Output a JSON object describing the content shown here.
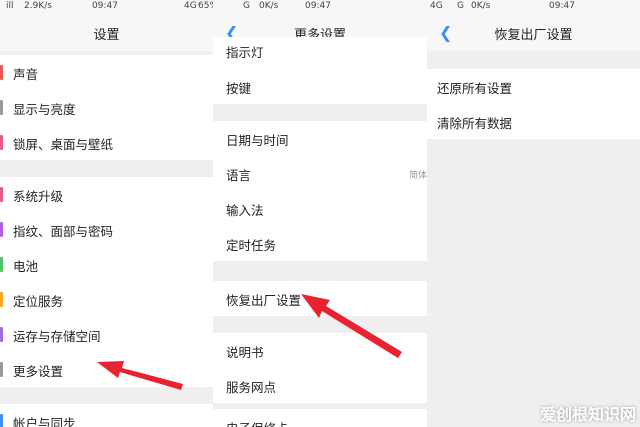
{
  "panel1": {
    "status": {
      "signal": "ill",
      "speed": "2.9K/s",
      "time": "09:47",
      "net": "4G",
      "battery": "65%"
    },
    "title": "设置",
    "items": [
      {
        "label": "声音",
        "color": "#e85a4f"
      },
      {
        "label": "显示与亮度",
        "color": "#999999"
      },
      {
        "label": "锁屏、桌面与壁纸",
        "color": "#e85a8f"
      },
      {
        "label": "系统升级",
        "color": "#e85a8f"
      },
      {
        "label": "指纹、面部与密码",
        "color": "#b35de0"
      },
      {
        "label": "电池",
        "color": "#4fc463"
      },
      {
        "label": "定位服务",
        "color": "#f5a623"
      },
      {
        "label": "运存与存储空间",
        "color": "#9b6de0"
      },
      {
        "label": "更多设置",
        "color": "#999999"
      },
      {
        "label": "帐户与同步",
        "color": "#3d8ef0"
      }
    ]
  },
  "panel2": {
    "status": {
      "signal": "G",
      "speed": "0K/s",
      "time": "09:47"
    },
    "title": "更多设置",
    "items": [
      {
        "label": "指示灯"
      },
      {
        "label": "按键"
      },
      {
        "label": "日期与时间"
      },
      {
        "label": "语言",
        "value": "简体"
      },
      {
        "label": "输入法"
      },
      {
        "label": "定时任务"
      },
      {
        "label": "恢复出厂设置"
      },
      {
        "label": "说明书"
      },
      {
        "label": "服务网点"
      },
      {
        "label": "电子保修卡"
      }
    ]
  },
  "panel3": {
    "status": {
      "net": "4G",
      "signal": "G",
      "speed": "0K/s",
      "time": "09:47"
    },
    "title": "恢复出厂设置",
    "items": [
      {
        "label": "还原所有设置"
      },
      {
        "label": "清除所有数据"
      }
    ]
  },
  "watermark": "爱创根知识网",
  "accent": "#3d8ef0",
  "arrow_color": "#e8222e"
}
